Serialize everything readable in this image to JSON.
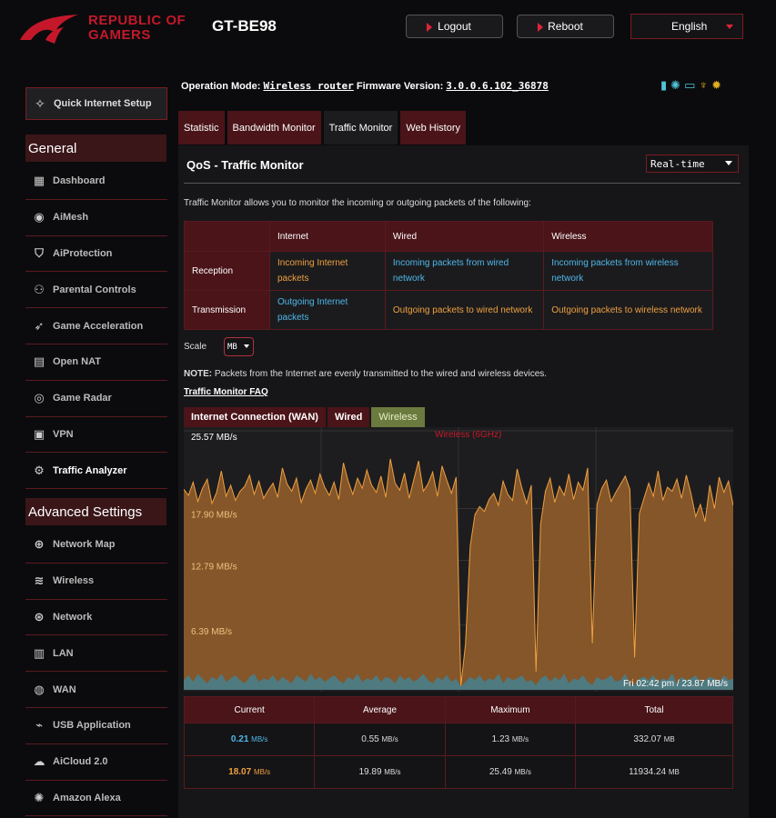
{
  "header": {
    "brand_line1": "REPUBLIC OF",
    "brand_line2": "GAMERS",
    "model": "GT-BE98",
    "logout": "Logout",
    "reboot": "Reboot",
    "language": "English"
  },
  "sidebar": {
    "quick_setup": "Quick Internet Setup",
    "general_title": "General",
    "general_items": [
      {
        "label": "Dashboard",
        "icon": "dashboard-icon"
      },
      {
        "label": "AiMesh",
        "icon": "aimesh-icon"
      },
      {
        "label": "AiProtection",
        "icon": "shield-icon"
      },
      {
        "label": "Parental Controls",
        "icon": "parental-icon"
      },
      {
        "label": "Game Acceleration",
        "icon": "rocket-icon"
      },
      {
        "label": "Open NAT",
        "icon": "nat-icon"
      },
      {
        "label": "Game Radar",
        "icon": "radar-icon"
      },
      {
        "label": "VPN",
        "icon": "vpn-icon"
      },
      {
        "label": "Traffic Analyzer",
        "icon": "analyzer-icon"
      }
    ],
    "advanced_title": "Advanced Settings",
    "advanced_items": [
      {
        "label": "Network Map",
        "icon": "globe-icon"
      },
      {
        "label": "Wireless",
        "icon": "wifi-icon"
      },
      {
        "label": "Network",
        "icon": "network-icon"
      },
      {
        "label": "LAN",
        "icon": "lan-icon"
      },
      {
        "label": "WAN",
        "icon": "wan-icon"
      },
      {
        "label": "USB Application",
        "icon": "usb-icon"
      },
      {
        "label": "AiCloud 2.0",
        "icon": "cloud-icon"
      },
      {
        "label": "Amazon Alexa",
        "icon": "alexa-icon"
      }
    ]
  },
  "top": {
    "op_mode_label": "Operation Mode:",
    "op_mode_value": "Wireless router",
    "fw_label": "Firmware Version:",
    "fw_value": "3.0.0.6.102_36878"
  },
  "tabs": [
    "Statistic",
    "Bandwidth Monitor",
    "Traffic Monitor",
    "Web History"
  ],
  "main": {
    "title": "QoS - Traffic Monitor",
    "mode_select": "Real-time",
    "description": "Traffic Monitor allows you to monitor the incoming or outgoing packets of the following:",
    "table": {
      "headers": [
        "Internet",
        "Wired",
        "Wireless"
      ],
      "rows": [
        {
          "label": "Reception",
          "cells": [
            "Incoming Internet packets",
            "Incoming packets from wired network",
            "Incoming packets from wireless network"
          ]
        },
        {
          "label": "Transmission",
          "cells": [
            "Outgoing Internet packets",
            "Outgoing packets to wired network",
            "Outgoing packets to wireless network"
          ]
        }
      ]
    },
    "scale_label": "Scale",
    "scale_value": "MB",
    "note_bold": "NOTE:",
    "note_text": " Packets from the Internet are evenly transmitted to the wired and wireless devices.",
    "faq_link": "Traffic Monitor FAQ",
    "chart_tabs": [
      "Internet Connection (WAN)",
      "Wired",
      "Wireless"
    ]
  },
  "chart_data": {
    "type": "area",
    "series_label": "Wireless (6GHz)",
    "y_labels": [
      "25.57 MB/s",
      "17.90 MB/s",
      "12.79 MB/s",
      "6.39 MB/s"
    ],
    "ylim": [
      0,
      25.57
    ],
    "readout": "Fri 02:42 pm / 23.87 MB/s",
    "colors": {
      "rx": "#8a5a2a",
      "rx_line": "#f0a040",
      "tx": "#4e7a80"
    },
    "rx_values": [
      19.8,
      19.2,
      20.5,
      18.6,
      19.9,
      20.8,
      18.4,
      19.5,
      21.6,
      19.1,
      20.2,
      18.7,
      19.6,
      20.1,
      21.2,
      19.3,
      20.6,
      18.9,
      19.7,
      20.4,
      19.0,
      21.9,
      20.3,
      19.6,
      20.9,
      18.5,
      19.8,
      20.7,
      19.4,
      21.3,
      20.0,
      19.2,
      20.5,
      18.8,
      22.4,
      20.6,
      19.3,
      20.9,
      19.9,
      21.7,
      20.2,
      19.5,
      21.1,
      19.0,
      22.8,
      20.4,
      19.7,
      21.4,
      18.9,
      20.8,
      22.6,
      19.6,
      20.3,
      21.5,
      19.1,
      22.1,
      20.7,
      19.4,
      21.0,
      0.4,
      4.5,
      14.2,
      17.3,
      18.1,
      17.6,
      18.8,
      19.4,
      18.2,
      20.6,
      19.3,
      18.7,
      21.8,
      19.9,
      18.4,
      20.2,
      1.8,
      16.4,
      19.6,
      20.9,
      18.5,
      20.1,
      19.2,
      21.3,
      18.8,
      20.5,
      19.7,
      21.9,
      4.6,
      18.3,
      19.9,
      20.7,
      18.6,
      19.5,
      20.3,
      21.1,
      19.8,
      3.2,
      17.4,
      18.9,
      20.4,
      19.1,
      21.6,
      18.7,
      20.0,
      19.6,
      20.8,
      18.9,
      21.2,
      19.4,
      17.1,
      18.3,
      16.6,
      20.2,
      17.9,
      21.0,
      19.5,
      20.6,
      18.2
    ],
    "tx_values": [
      0.6,
      0.9,
      0.5,
      1.0,
      0.7,
      0.4,
      0.8,
      0.6,
      1.0,
      0.5,
      0.7,
      0.9,
      0.6,
      0.4,
      0.8,
      1.0,
      0.5,
      0.7,
      0.6,
      0.9,
      0.5,
      0.8,
      0.6,
      0.4,
      0.9,
      0.7,
      0.5,
      1.0,
      0.6,
      0.8,
      0.5,
      0.7,
      0.9,
      0.6,
      0.4,
      0.8,
      0.6,
      1.0,
      0.5,
      0.7,
      0.6,
      0.9,
      0.5,
      0.8,
      0.7,
      0.4,
      0.9,
      0.6,
      0.8,
      0.5,
      0.7,
      1.0,
      0.6,
      0.4,
      0.8,
      0.6,
      0.9,
      0.5,
      0.7,
      0.2,
      0.5,
      0.8,
      0.6,
      0.9,
      0.5,
      0.7,
      0.6,
      1.0,
      0.4,
      0.8,
      0.6,
      0.7,
      0.9,
      0.5,
      0.6,
      0.3,
      0.7,
      0.9,
      0.5,
      0.8,
      0.6,
      1.0,
      0.4,
      0.7,
      0.6,
      0.9,
      0.5,
      0.3,
      0.8,
      0.6,
      0.7,
      0.9,
      0.5,
      0.6,
      1.0,
      0.4,
      0.3,
      0.7,
      0.8,
      0.6,
      0.9,
      0.5,
      0.7,
      0.6,
      1.0,
      0.4,
      0.8,
      0.6,
      0.7,
      0.9,
      0.5,
      0.6,
      0.8,
      0.7,
      0.5,
      0.9,
      0.6,
      0.7
    ]
  },
  "stats": {
    "headers": [
      "Current",
      "Average",
      "Maximum",
      "Total"
    ],
    "rows": [
      {
        "current": "0.21",
        "current_unit": "MB/s",
        "average": "0.55",
        "average_unit": "MB/s",
        "maximum": "1.23",
        "maximum_unit": "MB/s",
        "total": "332.07",
        "total_unit": "MB"
      },
      {
        "current": "18.07",
        "current_unit": "MB/s",
        "average": "19.89",
        "average_unit": "MB/s",
        "maximum": "25.49",
        "maximum_unit": "MB/s",
        "total": "11934.24",
        "total_unit": "MB"
      }
    ]
  }
}
